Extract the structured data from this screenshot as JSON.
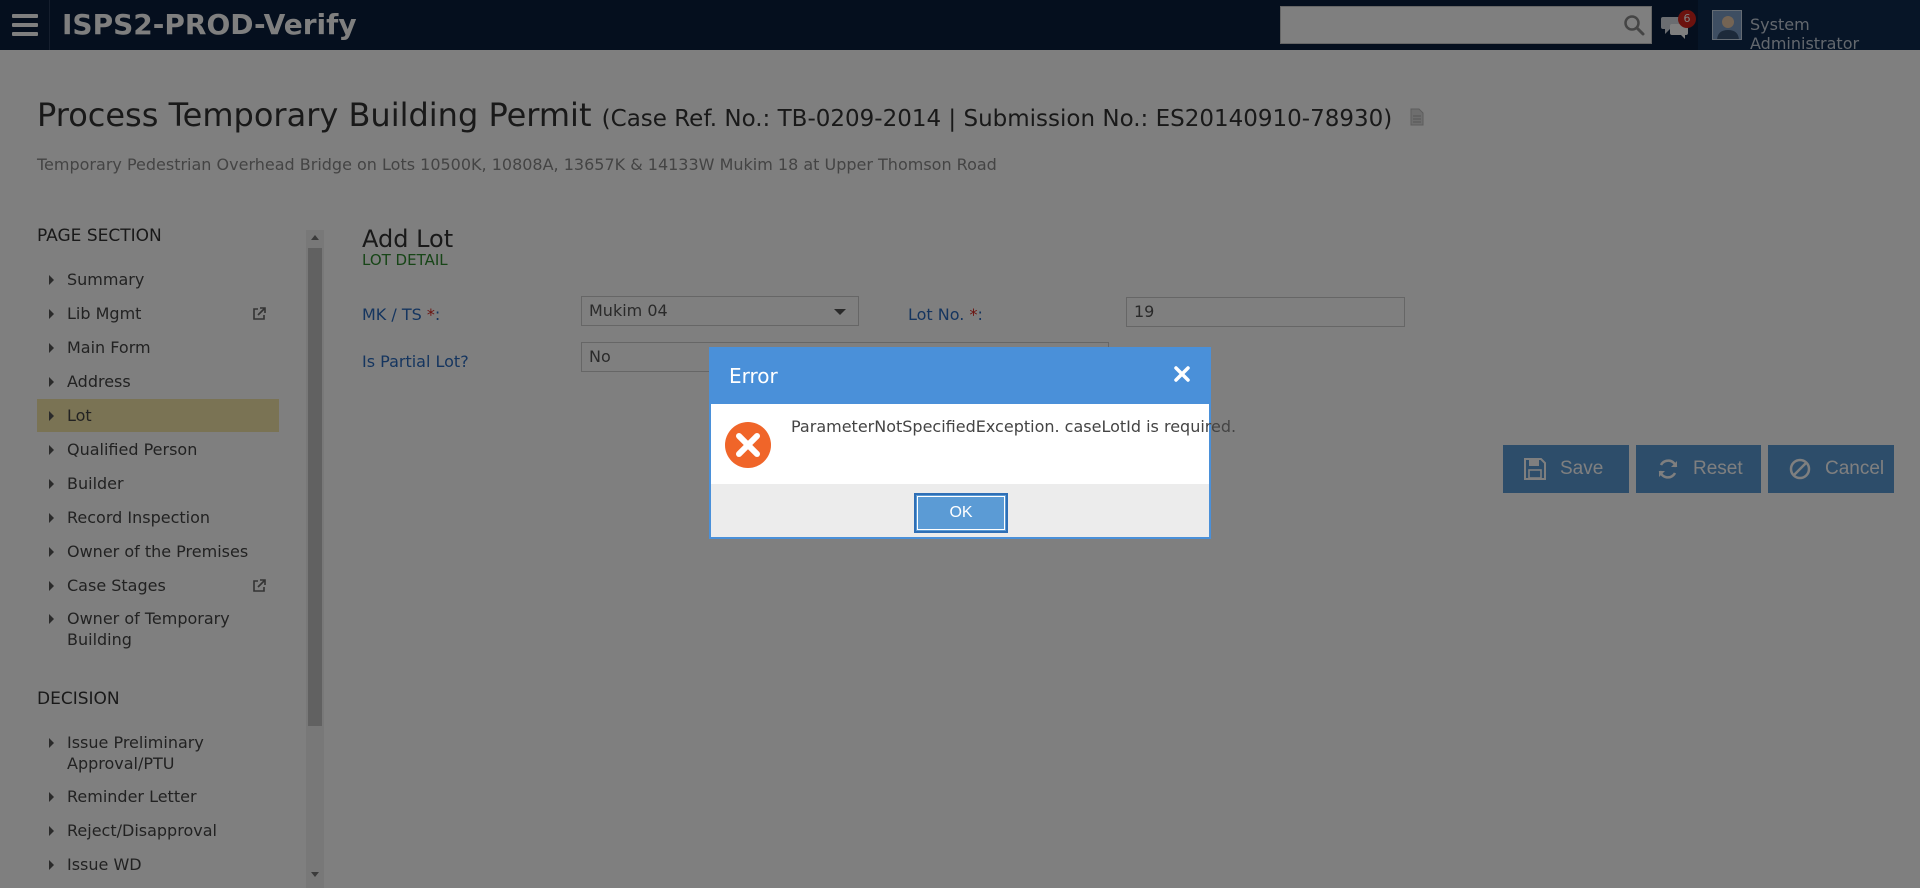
{
  "topbar": {
    "app_title": "ISPS2-PROD-Verify",
    "search": {
      "value": "",
      "placeholder": ""
    },
    "notification_count": "6",
    "user_name": "System Administrator"
  },
  "page": {
    "title": "Process Temporary Building Permit",
    "subref": "(Case Ref. No.: TB-0209-2014 | Submission No.: ES20140910-78930)",
    "description": "Temporary Pedestrian Overhead Bridge on Lots 10500K, 10808A, 13657K & 14133W Mukim 18 at Upper Thomson Road"
  },
  "sidebar": {
    "page_section_heading": "PAGE SECTION",
    "page_section_items": [
      {
        "label": "Summary"
      },
      {
        "label": "Lib Mgmt"
      },
      {
        "label": "Main Form"
      },
      {
        "label": "Address"
      },
      {
        "label": "Lot"
      },
      {
        "label": "Qualified Person"
      },
      {
        "label": "Builder"
      },
      {
        "label": "Record Inspection"
      },
      {
        "label": "Owner of the Premises"
      },
      {
        "label": "Case Stages"
      },
      {
        "label": "Owner of Temporary Building"
      }
    ],
    "decision_heading": "DECISION",
    "decision_items": [
      {
        "label": "Issue Preliminary Approval/PTU"
      },
      {
        "label": "Reminder Letter"
      },
      {
        "label": "Reject/Disapproval"
      },
      {
        "label": "Issue WD"
      }
    ]
  },
  "form": {
    "title": "Add Lot",
    "subtitle": "LOT DETAIL",
    "mk_ts_label": "MK / TS",
    "mk_ts_value": "Mukim 04",
    "lot_no_label": "Lot No.",
    "lot_no_value": "19",
    "partial_label": "Is Partial Lot?",
    "partial_value": "No",
    "required_mark": "*",
    "label_colon": ":",
    "save_label": "Save",
    "reset_label": "Reset",
    "cancel_label": "Cancel"
  },
  "modal": {
    "title": "Error",
    "message": "ParameterNotSpecifiedException. caseLotId is required.",
    "ok_label": "OK"
  },
  "colors": {
    "topbar": "#0a1f3c",
    "accent": "#4a90d9",
    "button": "#5b9bd5",
    "active_nav": "#f5e6a8",
    "error": "#f06529",
    "badge": "#d9241c"
  },
  "icons": {
    "menu": "hamburger-icon",
    "search": "search-icon",
    "chat": "chat-icon",
    "external": "external-link-icon",
    "save": "floppy-disk-icon",
    "reset": "refresh-icon",
    "cancel": "ban-icon",
    "error": "error-x-icon",
    "close": "close-icon"
  }
}
